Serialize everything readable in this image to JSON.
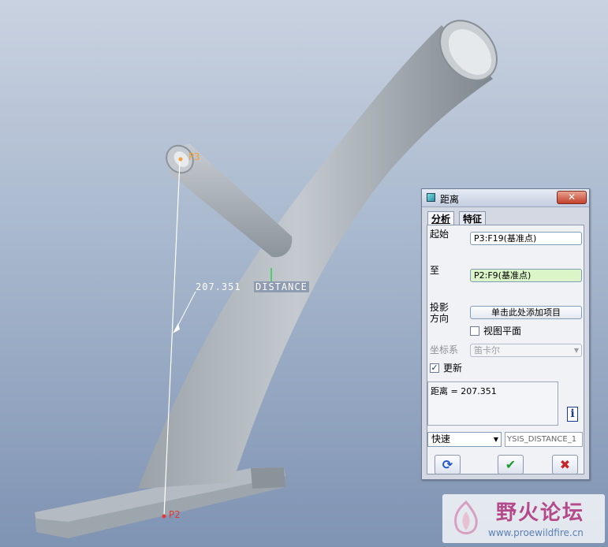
{
  "viewport": {
    "dimension_value": "207.351",
    "dimension_tag": "DISTANCE",
    "point_p3": "P3",
    "point_p2": "P2"
  },
  "dialog": {
    "title": "距离",
    "close": "✕",
    "tabs": {
      "analysis": "分析",
      "feature": "特征"
    },
    "from_label": "起始",
    "from_value": "P3:F19(基准点)",
    "to_label": "至",
    "to_value": "P2:F9(基准点)",
    "proj_label_line1": "投影",
    "proj_label_line2": "方向",
    "proj_button": "单击此处添加项目",
    "view_plane": "视图平面",
    "coord_label": "坐标系",
    "coord_value": "笛卡尔",
    "update_label": "更新",
    "update_check": "✓",
    "result": "距离  = 207.351",
    "mode_value": "快速",
    "name_value": "YSIS_DISTANCE_1",
    "info": "i",
    "repeat": "⟳",
    "ok": "✔",
    "cancel": "✖"
  },
  "watermark": {
    "title": "野火论坛",
    "url": "www.proewildfire.cn"
  },
  "colors": {
    "point_p3": "#f2a13b",
    "point_p2": "#e03a3a",
    "to_field_bg": "#dcf5c8",
    "watermark_text": "#b44a8a"
  }
}
